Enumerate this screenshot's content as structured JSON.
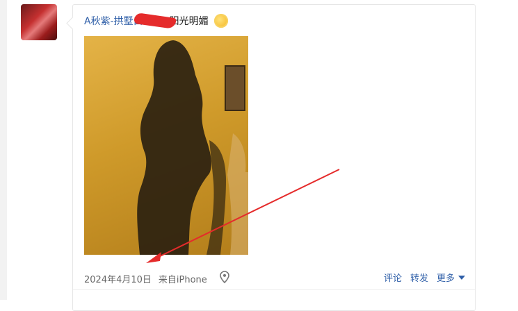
{
  "post": {
    "author": "A秋紫-拱墅白",
    "status_text": "阳光明媚",
    "status_emoji": "sun-emoji",
    "date": "2024年4月10日",
    "source": "来自iPhone",
    "actions": {
      "comment": "评论",
      "repost": "转发",
      "more": "更多"
    }
  },
  "colors": {
    "link": "#2f5fa8",
    "annotation": "#e52b2b",
    "photo_tone": "#cf9a2a"
  }
}
